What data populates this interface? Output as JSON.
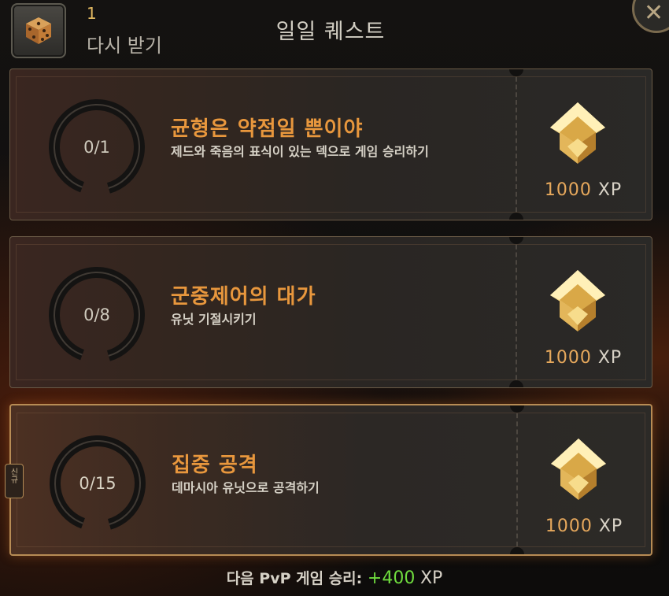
{
  "header": {
    "reroll_count": "1",
    "reroll_label": "다시 받기",
    "title": "일일 퀘스트",
    "close_glyph": "✕",
    "dice_icon": "dice-icon"
  },
  "quests": [
    {
      "progress": "0/1",
      "progress_fraction": 0,
      "title": "균형은 약점일 뿐이야",
      "description": "제드와 죽음의 표식이 있는 덱으로 게임 승리하기",
      "reward_value": "1000",
      "reward_unit": "XP"
    },
    {
      "progress": "0/8",
      "progress_fraction": 0,
      "title": "군중제어의 대가",
      "description": "유닛 기절시키기",
      "reward_value": "1000",
      "reward_unit": "XP"
    },
    {
      "progress": "0/15",
      "progress_fraction": 0,
      "title": "집중 공격",
      "description": "데마시아 유닛으로 공격하기",
      "reward_value": "1000",
      "reward_unit": "XP"
    }
  ],
  "side_tab": {
    "label": "신규"
  },
  "footer": {
    "label": "다음 PvP 게임 승리:",
    "bonus": "+400",
    "unit": "XP"
  },
  "colors": {
    "accent": "#e8973d",
    "xp_value": "#e6a85c",
    "bonus": "#6fdc3e",
    "highlight_border": "#b78c55"
  }
}
